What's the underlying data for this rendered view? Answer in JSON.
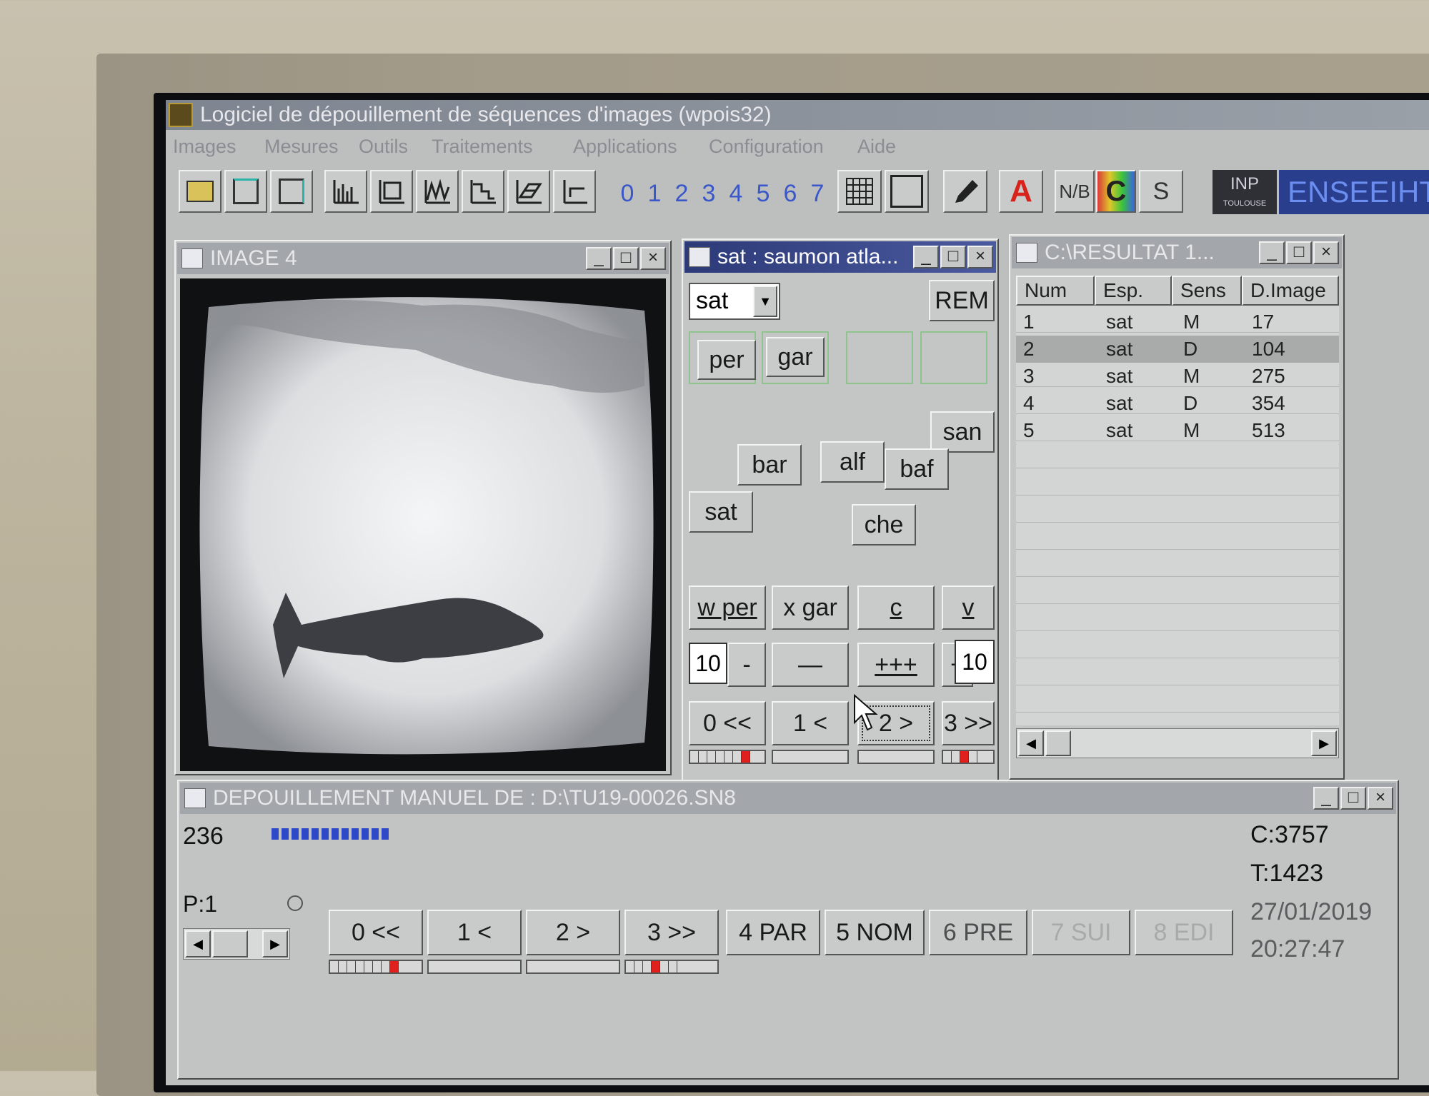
{
  "app": {
    "title": "Logiciel de dépouillement de séquences d'images (wpois32)"
  },
  "menu": [
    "Images",
    "Mesures",
    "Outils",
    "Traitements",
    "Applications",
    "Configuration",
    "Aide"
  ],
  "toolbar": {
    "numbers": [
      "0",
      "1",
      "2",
      "3",
      "4",
      "5",
      "6",
      "7"
    ],
    "nb_label": "N/B",
    "c_label": "C",
    "s_label": "S",
    "text_tool_label": "A",
    "logo_inp": "INP",
    "logo_inp_sub": "TOULOUSE",
    "logo_ens": "ENSEEIHT"
  },
  "image_window": {
    "title": "IMAGE 4"
  },
  "species_window": {
    "title": "sat : saumon atla...",
    "species_select": "sat",
    "rem_button": "REM",
    "per_button": "per",
    "gar_button": "gar",
    "species_buttons": [
      "san",
      "bar",
      "alf",
      "baf",
      "sat",
      "che"
    ],
    "w_per": "w per",
    "x_gar": "x gar",
    "c_btn": "c",
    "v_btn": "v",
    "left_value": "10",
    "minus_btn": "-",
    "dash_btn": "—",
    "plusplus_btn": "+++",
    "plus_btn": "+",
    "right_value": "10",
    "nav": [
      "0 <<",
      "1 <",
      "2 >",
      "3 >>"
    ]
  },
  "results_window": {
    "title": "C:\\RESULTAT 1...",
    "columns": [
      "Num",
      "Esp.",
      "Sens",
      "D.Image"
    ],
    "rows": [
      [
        "1",
        "sat",
        "M",
        "17"
      ],
      [
        "2",
        "sat",
        "D",
        "104"
      ],
      [
        "3",
        "sat",
        "M",
        "275"
      ],
      [
        "4",
        "sat",
        "D",
        "354"
      ],
      [
        "5",
        "sat",
        "M",
        "513"
      ]
    ],
    "selected_row": 1
  },
  "manual_window": {
    "title": "DEPOUILLEMENT MANUEL DE : D:\\TU19-00026.SN8",
    "frame": "236",
    "p_label": "P:1",
    "nav": [
      "0 <<",
      "1 <",
      "2 >",
      "3 >>",
      "4 PAR",
      "5 NOM",
      "6 PRE",
      "7 SUI",
      "8 EDI"
    ],
    "c_value": "C:3757",
    "t_value": "T:1423",
    "date": "27/01/2019",
    "time": "20:27:47",
    "progress_fraction": 0.14
  },
  "colors": {
    "accent_blue": "#2a3e8e",
    "number_blue": "#3a57c9",
    "indicator_red": "#e0201c"
  }
}
